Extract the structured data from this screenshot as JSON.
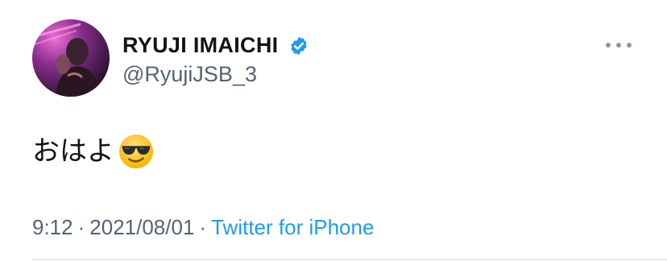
{
  "tweet": {
    "author": {
      "display_name": "RYUJI IMAICHI",
      "handle": "@RyujiJSB_3",
      "verified": true,
      "avatar_icon": "profile-photo"
    },
    "text": "おはよ",
    "emoji_icon": "smiling-face-with-sunglasses",
    "time": "9:12",
    "separator": "·",
    "date": "2021/08/01",
    "source": "Twitter for iPhone",
    "more_icon": "more-horizontal-icon"
  },
  "colors": {
    "text": "#0f1419",
    "secondary": "#536471",
    "link": "#1d9bf0",
    "verified_badge": "#1d9bf0",
    "divider": "#cfd9de"
  }
}
